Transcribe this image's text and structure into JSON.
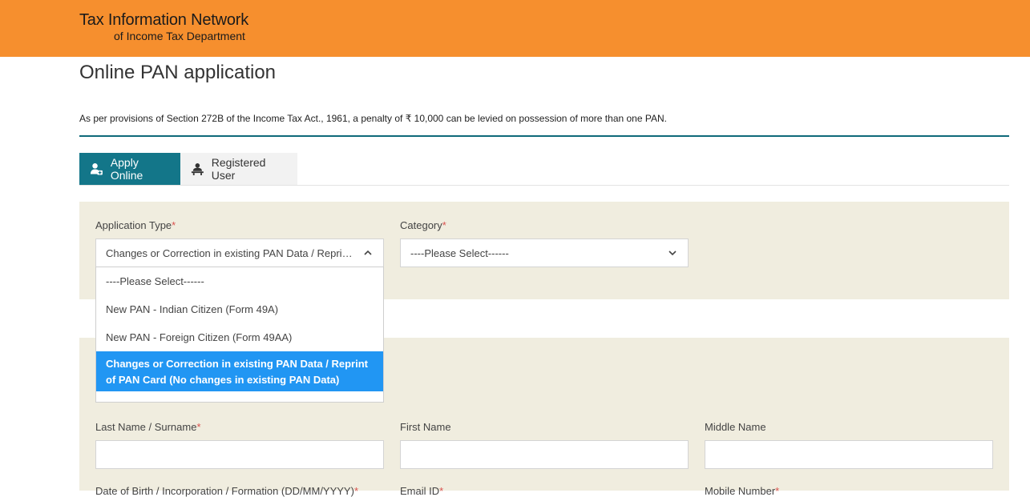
{
  "header": {
    "title_line1": "Tax Information Network",
    "title_line2": "of Income Tax Department",
    "bg_color": "#f68f2e"
  },
  "page": {
    "title": "Online PAN application",
    "notice": "As per provisions of Section 272B of the Income Tax Act., 1961, a penalty of ₹ 10,000 can be levied on possession of more than one PAN."
  },
  "tabs": [
    {
      "label": "Apply Online",
      "icon": "user-add-icon",
      "active": true
    },
    {
      "label": "Registered User",
      "icon": "registered-user-icon",
      "active": false
    }
  ],
  "form": {
    "application_type": {
      "label": "Application Type",
      "required_mark": "*",
      "value": "Changes or Correction in existing PAN Data / Reprint of PAN Card (No changes in existing PAN Data)",
      "expanded": true,
      "options": [
        "----Please Select------",
        "New PAN - Indian Citizen (Form 49A)",
        "New PAN - Foreign Citizen (Form 49AA)",
        "Changes or Correction in existing PAN Data / Reprint of PAN Card (No changes in existing PAN Data)"
      ],
      "selected_index": 3
    },
    "category": {
      "label": "Category",
      "required_mark": "*",
      "value": "----Please Select------"
    },
    "last_name": {
      "label": "Last Name / Surname",
      "required_mark": "*",
      "value": ""
    },
    "first_name": {
      "label": "First Name",
      "value": ""
    },
    "middle_name": {
      "label": "Middle Name",
      "value": ""
    },
    "next_row": {
      "dob": "Date of Birth / Incorporation / Formation (DD/MM/YYYY)",
      "dob_req": "*",
      "email": "Email ID",
      "email_req": "*",
      "mobile": "Mobile Number",
      "mobile_req": "*"
    }
  },
  "colors": {
    "accent": "#137689",
    "rule": "#0f6a7a",
    "panel": "#f0eddf",
    "selected_option": "#2196f3",
    "required": "#d9534f"
  }
}
